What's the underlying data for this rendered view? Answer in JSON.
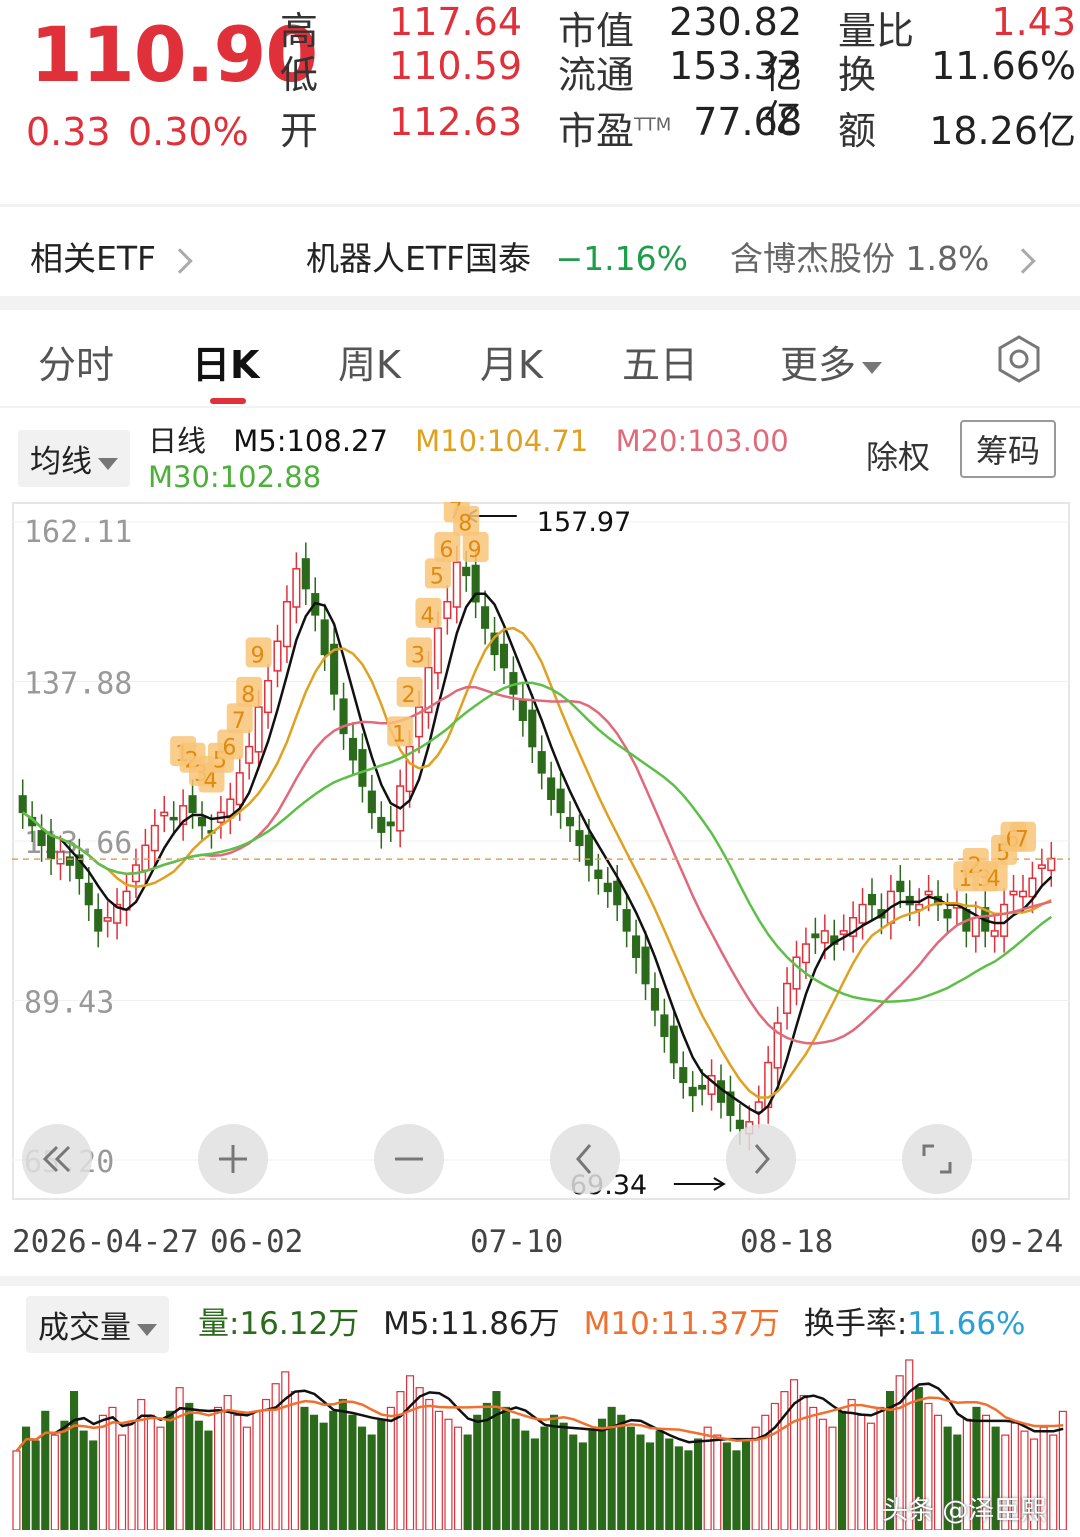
{
  "quote": {
    "price": "110.90",
    "change": "0.33",
    "change_pct": "0.30%",
    "fields": [
      {
        "label": "高",
        "value": "117.64",
        "color": "#e0303a"
      },
      {
        "label": "低",
        "value": "110.59",
        "color": "#e0303a"
      },
      {
        "label": "开",
        "value": "112.63",
        "color": "#e0303a"
      }
    ],
    "market": [
      {
        "label": "市值",
        "value": "230.82亿"
      },
      {
        "label": "流通",
        "value": "153.33亿"
      },
      {
        "label": "市盈",
        "sup": "TTM",
        "value": "77.68"
      }
    ],
    "ratio": [
      {
        "label": "量比",
        "value": "1.43",
        "color": "#e0303a"
      },
      {
        "label": "换",
        "value": "11.66%",
        "color": "#222222"
      },
      {
        "label": "额",
        "value": "18.26亿",
        "color": "#222222"
      }
    ]
  },
  "etf": {
    "label": "相关ETF",
    "name": "机器人ETF国泰",
    "change": "−1.16%",
    "holding": "含博杰股份 1.8%"
  },
  "tabs": [
    "分时",
    "日K",
    "周K",
    "月K",
    "五日",
    "更多"
  ],
  "active_tab": 1,
  "ma_bar": {
    "dropdown": "均线",
    "label": "日线",
    "m5": "M5:108.27",
    "m10": "M10:104.71",
    "m20": "M20:103.00",
    "m30": "M30:102.88",
    "fuquan": "除权",
    "chouma": "筹码"
  },
  "colors": {
    "up": "#e0303a",
    "down": "#2a6a1a",
    "m5": "#111111",
    "m10": "#e0a020",
    "m20": "#e06a7a",
    "m30": "#5cc048"
  },
  "chart_data": {
    "type": "candlestick",
    "y_ticks": [
      "162.11",
      "137.88",
      "113.66",
      "89.43",
      "65.20"
    ],
    "ylim": [
      65.2,
      162.11
    ],
    "x_ticks": [
      "2026-04-27",
      "06-02",
      "07-10",
      "08-18",
      "09-24"
    ],
    "annotations": [
      {
        "text": "157.97",
        "kind": "high"
      },
      {
        "text": "69.34",
        "kind": "low"
      }
    ],
    "latest_close": 110.9,
    "seq_labels": [
      "1",
      "2",
      "3",
      "4",
      "5",
      "6",
      "7",
      "8",
      "9"
    ],
    "closes": [
      118,
      116,
      113,
      111,
      112,
      110,
      108,
      104,
      100,
      102,
      104,
      106,
      110,
      113,
      116,
      118,
      117,
      119,
      118,
      116,
      115,
      118,
      120,
      124,
      128,
      134,
      138,
      144,
      150,
      155,
      152,
      148,
      142,
      136,
      130,
      126,
      122,
      118,
      115,
      116,
      122,
      128,
      134,
      140,
      146,
      150,
      156,
      154,
      150,
      146,
      142,
      140,
      136,
      132,
      128,
      124,
      120,
      118,
      116,
      113,
      110,
      108,
      106,
      104,
      100,
      96,
      92,
      88,
      84,
      80,
      77,
      75,
      76,
      78,
      74,
      72,
      70,
      71,
      74,
      80,
      86,
      92,
      96,
      98,
      99,
      100,
      98,
      100,
      102,
      104,
      104,
      102,
      106,
      106,
      104,
      104,
      106,
      104,
      102,
      104,
      100,
      102,
      100,
      100,
      104,
      106,
      106,
      108,
      110,
      111
    ]
  },
  "controls": [
    "rewind-button",
    "zoom-in-button",
    "zoom-out-button",
    "prev-button",
    "next-button",
    "fullscreen-button"
  ],
  "volume": {
    "dropdown": "成交量",
    "vol": "量:16.12万",
    "m5": "M5:11.86万",
    "m10": "M10:11.37万",
    "turnover_label": "换手率:",
    "turnover": "11.66%",
    "bars": [
      40,
      52,
      45,
      60,
      48,
      55,
      70,
      50,
      45,
      58,
      62,
      48,
      55,
      66,
      58,
      52,
      60,
      72,
      64,
      55,
      50,
      62,
      68,
      58,
      52,
      60,
      66,
      74,
      80,
      70,
      62,
      58,
      54,
      60,
      66,
      58,
      52,
      48,
      56,
      62,
      70,
      78,
      72,
      66,
      60,
      56,
      52,
      48,
      58,
      64,
      70,
      62,
      56,
      50,
      46,
      52,
      58,
      54,
      48,
      44,
      50,
      56,
      62,
      58,
      52,
      48,
      44,
      50,
      46,
      42,
      40,
      46,
      52,
      48,
      44,
      40,
      46,
      52,
      58,
      64,
      70,
      76,
      68,
      62,
      56,
      52,
      60,
      66,
      58,
      54,
      62,
      70,
      78,
      86,
      72,
      64,
      58,
      52,
      48,
      56,
      62,
      58,
      52,
      48,
      54,
      50,
      46,
      52,
      48,
      60
    ]
  },
  "watermark": "头条 @泽臣熙"
}
